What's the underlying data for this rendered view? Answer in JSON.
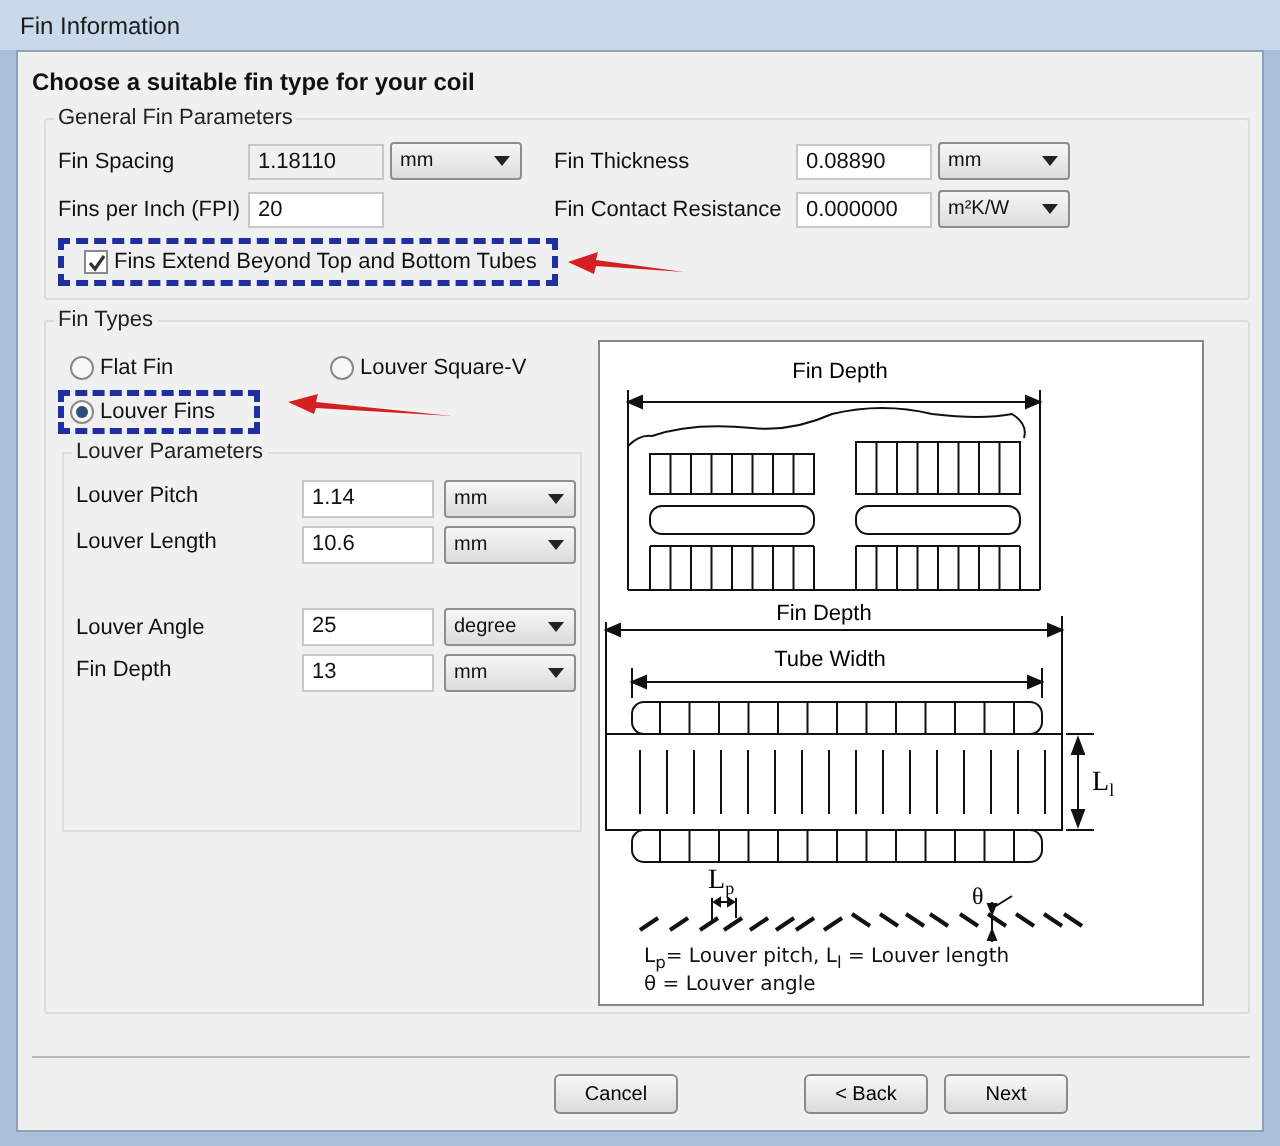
{
  "window": {
    "title": "Fin Information"
  },
  "heading": "Choose a suitable fin type for your coil",
  "general": {
    "title": "General Fin Parameters",
    "fields": [
      {
        "label": "Fin Spacing",
        "value": "1.18110",
        "unit": "mm",
        "disabled": true
      },
      {
        "label": "Fin Thickness",
        "value": "0.08890",
        "unit": "mm",
        "disabled": false
      },
      {
        "label": "Fins per Inch (FPI)",
        "value": "20",
        "disabled": false
      },
      {
        "label": "Fin Contact Resistance",
        "value": "0.000000",
        "unit": "m²K/W",
        "disabled": false
      }
    ],
    "extend_checkbox": {
      "label": "Fins Extend Beyond Top and Bottom Tubes",
      "checked": true
    }
  },
  "fin_types": {
    "title": "Fin Types",
    "options": [
      {
        "label": "Flat Fin",
        "selected": false
      },
      {
        "label": "Louver Square-V",
        "selected": false
      },
      {
        "label": "Louver Fins",
        "selected": true
      }
    ],
    "louver": {
      "title": "Louver Parameters",
      "fields": [
        {
          "label": "Louver Pitch",
          "value": "1.14",
          "unit": "mm"
        },
        {
          "label": "Louver Length",
          "value": "10.6",
          "unit": "mm"
        },
        {
          "label": "Louver Angle",
          "value": "25",
          "unit": "degree"
        },
        {
          "label": "Fin Depth",
          "value": "13",
          "unit": "mm"
        }
      ]
    },
    "diagram": {
      "top_label": "Fin Depth",
      "side_label": "Fin Depth",
      "tube_label": "Tube Width",
      "length_symbol": {
        "text": "L",
        "sub": "l"
      },
      "pitch_symbol": {
        "text": "L",
        "sub": "p"
      },
      "angle_symbol": "θ",
      "caption": [
        "L$_{p}$= Louver pitch, L$_{l}$ = Louver length",
        "θ = Louver angle"
      ]
    }
  },
  "buttons": [
    {
      "label": "Cancel"
    },
    {
      "label": "< Back"
    },
    {
      "label": "Next"
    }
  ]
}
